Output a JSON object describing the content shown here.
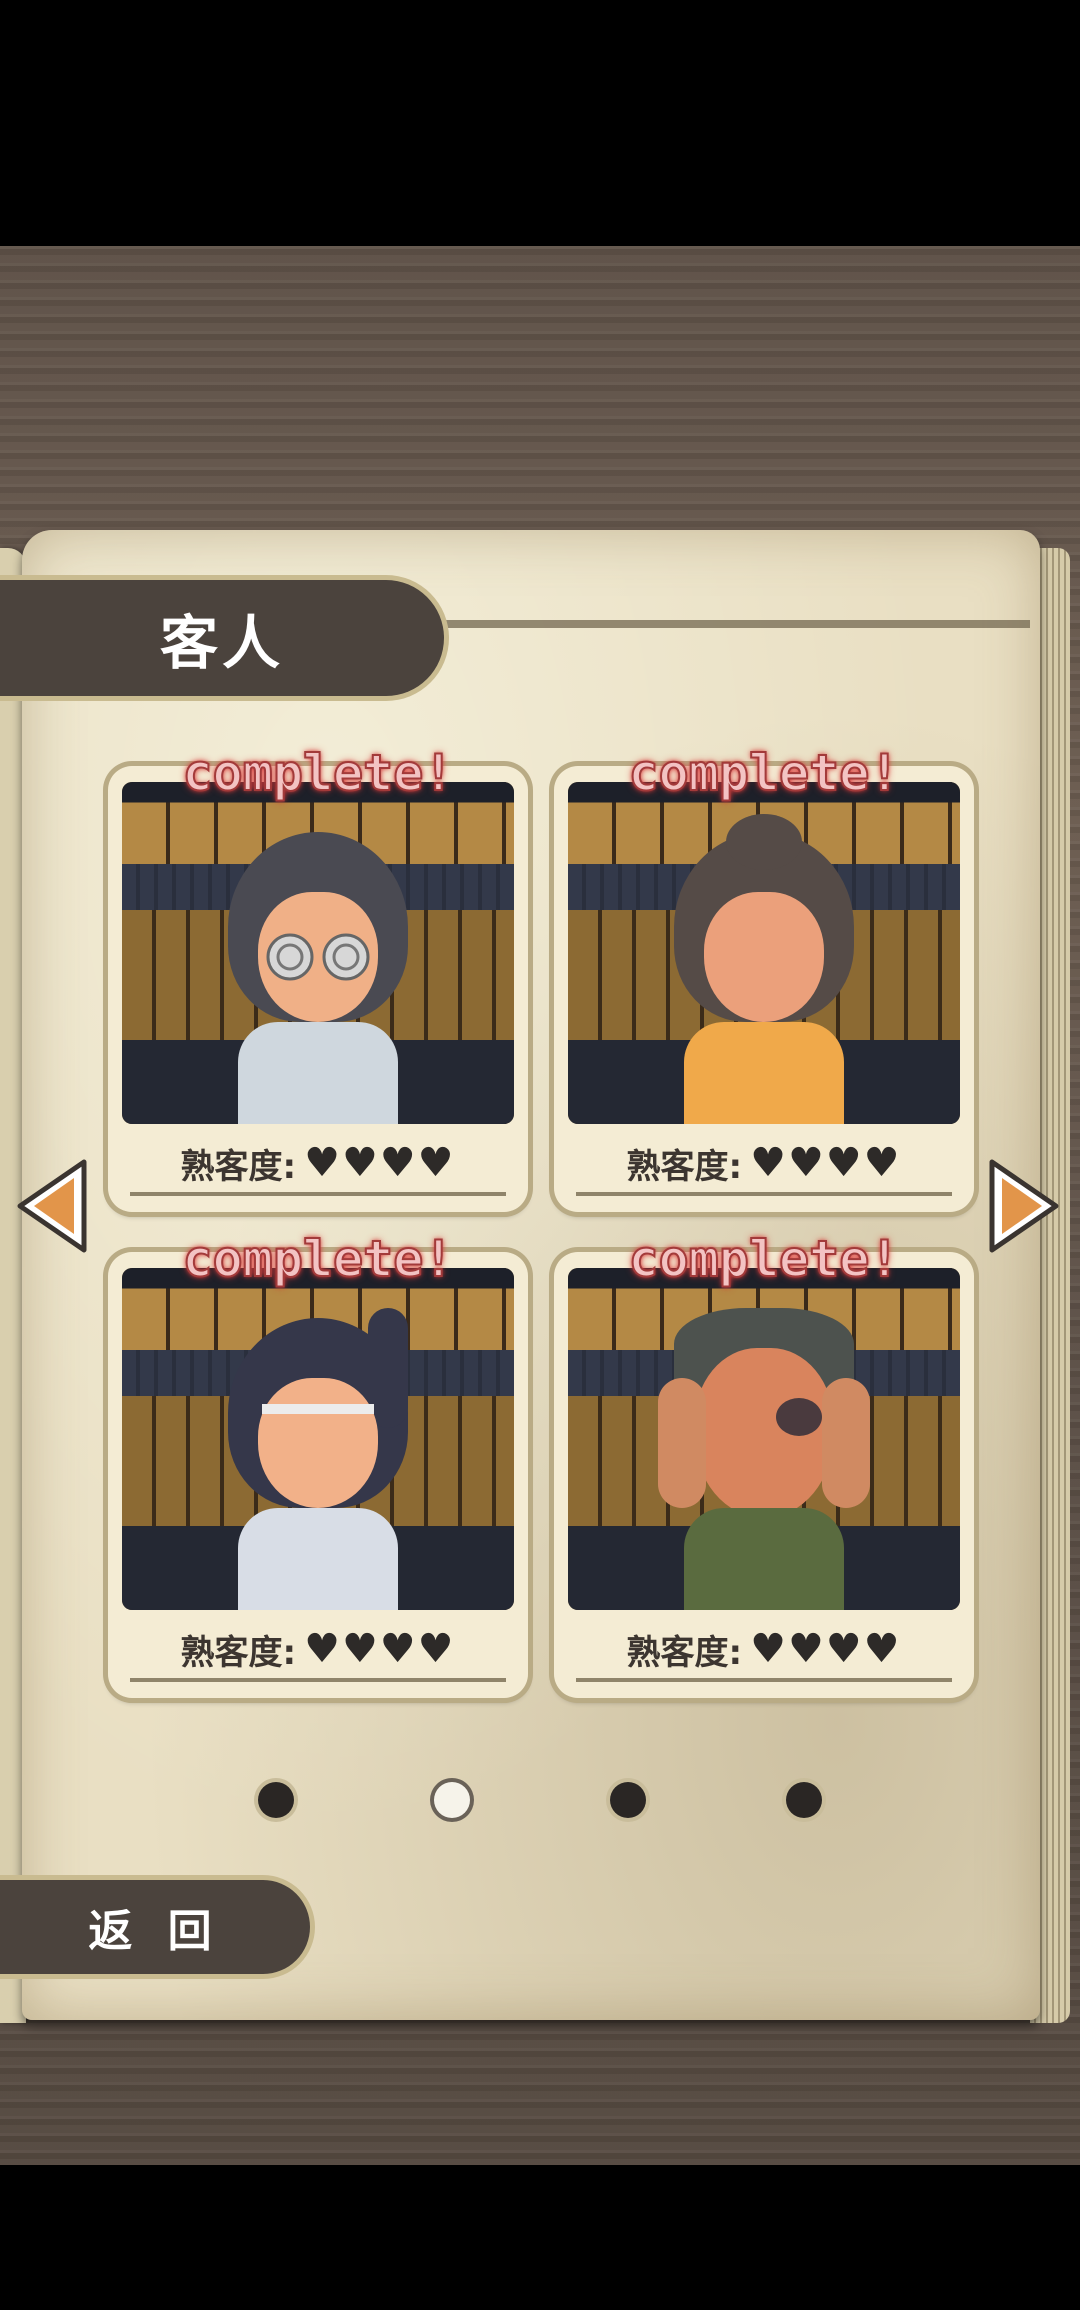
{
  "header": {
    "title": "客人"
  },
  "customers": [
    {
      "badge": "complete!",
      "label": "熟客度:",
      "hearts": "♥♥♥♥",
      "colors": {
        "hair": "#4a4a52",
        "body": "#cfd7de"
      }
    },
    {
      "badge": "complete!",
      "label": "熟客度:",
      "hearts": "♥♥♥♥",
      "colors": {
        "hair": "#554b47",
        "body": "#f0a94a"
      }
    },
    {
      "badge": "complete!",
      "label": "熟客度:",
      "hearts": "♥♥♥♥",
      "colors": {
        "hair": "#35374a",
        "body": "#d8dde6"
      }
    },
    {
      "badge": "complete!",
      "label": "熟客度:",
      "hearts": "♥♥♥♥",
      "colors": {
        "hair": "#4d524e",
        "body": "#5a6b3f"
      }
    }
  ],
  "pagination": {
    "active_index": 1,
    "count": 4
  },
  "footer": {
    "back_label": "返 回"
  },
  "colors": {
    "accent": "#e2954a",
    "panel": "#4b433d"
  }
}
